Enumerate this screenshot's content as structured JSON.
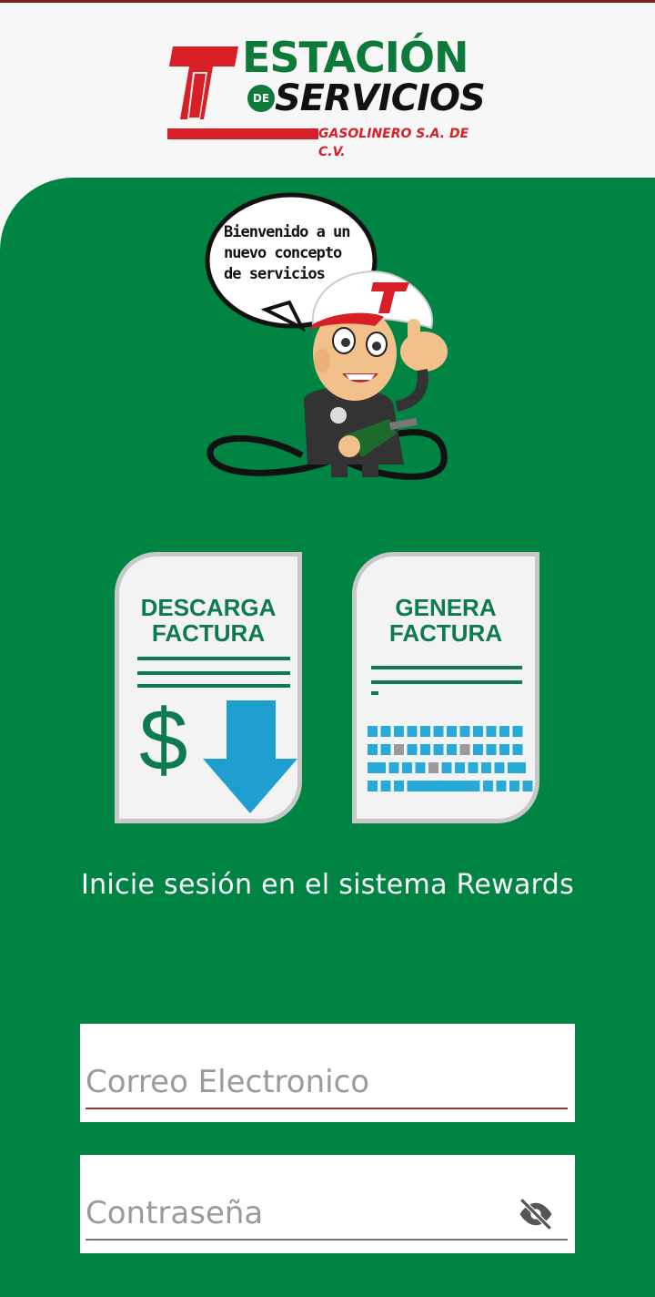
{
  "brand": {
    "line1": "ESTACIÓN",
    "de": "DE",
    "line2": "SERVICIOS",
    "line3": "GASOLINERO S.A. DE C.V.",
    "green": "#0e7a3a",
    "red": "#d81f26"
  },
  "mascot": {
    "bubble_text": "Bienvenido a un nuevo concepto de servicios"
  },
  "cards": {
    "download": {
      "line1": "DESCARGA",
      "line2": "FACTURA"
    },
    "generate": {
      "line1": "GENERA",
      "line2": "FACTURA"
    }
  },
  "login": {
    "prompt": "Inicie sesión en el sistema Rewards",
    "email_placeholder": "Correo Electronico",
    "password_placeholder": "Contraseña"
  },
  "colors": {
    "background_green": "#008443",
    "header_bg": "#f7f7f7"
  },
  "icons": {
    "password_toggle": "eye-off-icon",
    "download": "download-arrow-icon",
    "keyboard": "keyboard-icon",
    "dollar": "dollar-icon"
  }
}
